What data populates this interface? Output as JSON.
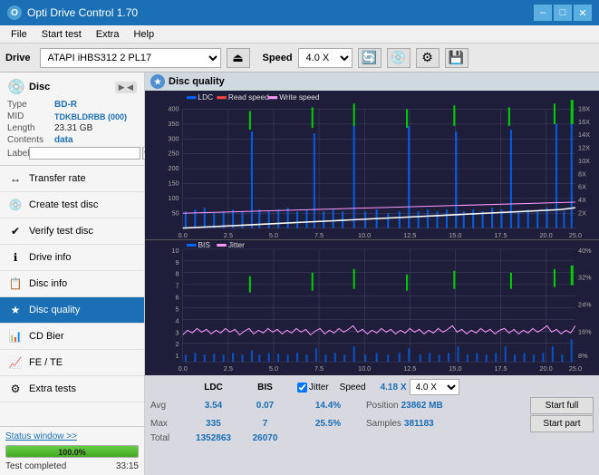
{
  "titlebar": {
    "title": "Opti Drive Control 1.70",
    "min_label": "–",
    "max_label": "□",
    "close_label": "✕"
  },
  "menubar": {
    "items": [
      "File",
      "Start test",
      "Extra",
      "Help"
    ]
  },
  "drivebar": {
    "drive_label": "Drive",
    "drive_value": "(J:)  ATAPI iHBS312  2 PL17",
    "speed_label": "Speed",
    "speed_value": "4.0 X"
  },
  "sidebar": {
    "disc_label": "Disc",
    "disc_type": "BD-R",
    "disc_info": [
      {
        "label": "Type",
        "value": "BD-R",
        "blue": true
      },
      {
        "label": "MID",
        "value": "TDKBLDRBB (000)",
        "blue": true
      },
      {
        "label": "Length",
        "value": "23.31 GB",
        "blue": false
      },
      {
        "label": "Contents",
        "value": "data",
        "blue": true
      }
    ],
    "label_placeholder": "",
    "nav_items": [
      {
        "label": "Transfer rate",
        "icon": "↔",
        "active": false
      },
      {
        "label": "Create test disc",
        "icon": "💿",
        "active": false
      },
      {
        "label": "Verify test disc",
        "icon": "✔",
        "active": false
      },
      {
        "label": "Drive info",
        "icon": "ℹ",
        "active": false
      },
      {
        "label": "Disc info",
        "icon": "📋",
        "active": false
      },
      {
        "label": "Disc quality",
        "icon": "★",
        "active": true
      },
      {
        "label": "CD Bier",
        "icon": "📊",
        "active": false
      },
      {
        "label": "FE / TE",
        "icon": "📈",
        "active": false
      },
      {
        "label": "Extra tests",
        "icon": "⚙",
        "active": false
      }
    ],
    "status_window_label": "Status window >>",
    "progress_pct": 100,
    "progress_label": "100.0%",
    "status_text": "Test completed",
    "time_text": "33:15"
  },
  "chart_panel": {
    "header": "Disc quality",
    "chart1": {
      "legend": [
        {
          "color": "#0066cc",
          "label": "LDC"
        },
        {
          "color": "#ff4444",
          "label": "Read speed"
        },
        {
          "color": "#ff99ff",
          "label": "Write speed"
        }
      ],
      "y_max": 400,
      "x_max": 25,
      "y_labels_left": [
        "400",
        "350",
        "300",
        "250",
        "200",
        "150",
        "100",
        "50"
      ],
      "y_labels_right": [
        "18X",
        "16X",
        "14X",
        "12X",
        "10X",
        "8X",
        "6X",
        "4X",
        "2X"
      ]
    },
    "chart2": {
      "legend": [
        {
          "color": "#0066cc",
          "label": "BIS"
        },
        {
          "color": "#ff99ff",
          "label": "Jitter"
        }
      ],
      "y_max": 10,
      "x_max": 25,
      "y_labels_left": [
        "10",
        "9",
        "8",
        "7",
        "6",
        "5",
        "4",
        "3",
        "2",
        "1"
      ],
      "y_labels_right": [
        "40%",
        "32%",
        "24%",
        "16%",
        "8%"
      ]
    }
  },
  "stats": {
    "headers": [
      "",
      "LDC",
      "BIS",
      "Jitter",
      "Speed",
      ""
    ],
    "avg": {
      "ldc": "3.54",
      "bis": "0.07",
      "jitter": "14.4%"
    },
    "max": {
      "ldc": "335",
      "bis": "7",
      "jitter": "25.5%"
    },
    "total": {
      "ldc": "1352863",
      "bis": "26070"
    },
    "speed_current": "4.18 X",
    "speed_select": "4.0 X",
    "position_label": "Position",
    "position_val": "23862 MB",
    "samples_label": "Samples",
    "samples_val": "381183",
    "jitter_checked": true,
    "jitter_label": "Jitter",
    "btn_start_full": "Start full",
    "btn_start_part": "Start part"
  }
}
